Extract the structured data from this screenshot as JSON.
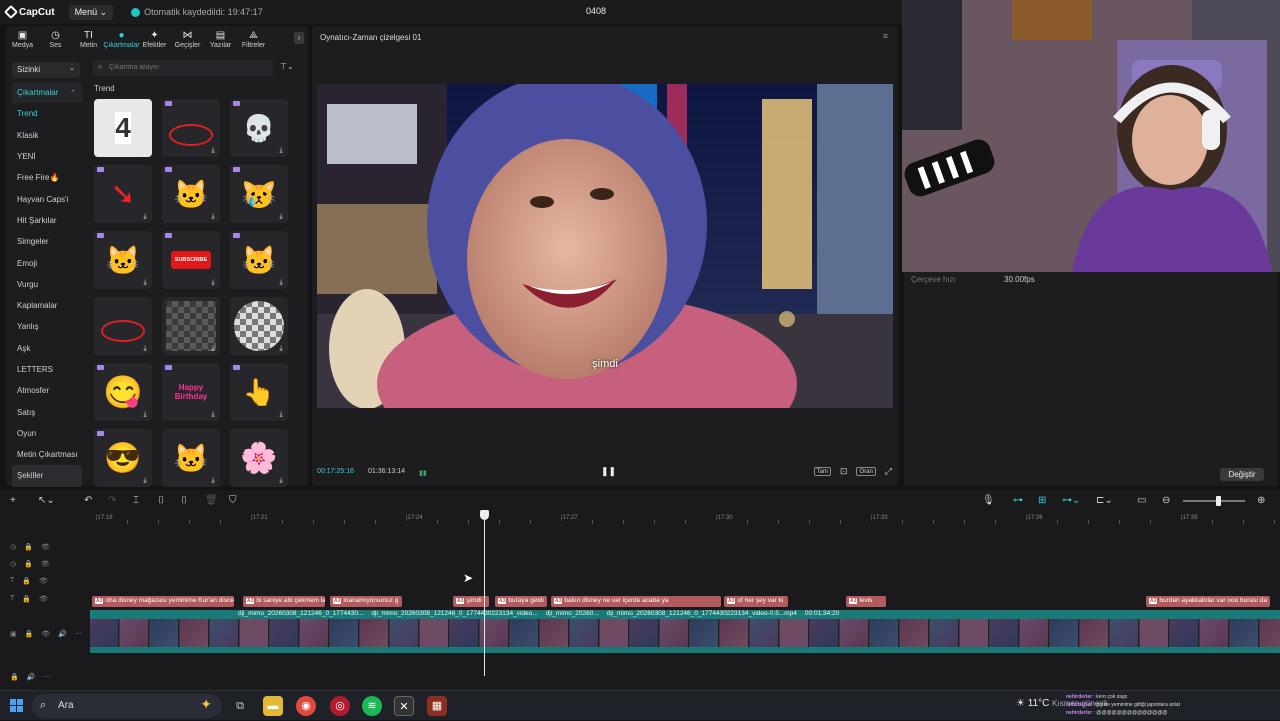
{
  "app": {
    "brand": "CapCut",
    "menu_label": "Menü",
    "autosave": "Otomatik kaydedildi: 19:47:17",
    "project_name": "0408"
  },
  "toolbar": {
    "items": [
      {
        "label": "Medya",
        "icon": "media-icon",
        "glyph": "▣"
      },
      {
        "label": "Ses",
        "icon": "audio-icon",
        "glyph": "◷"
      },
      {
        "label": "Metin",
        "icon": "text-icon",
        "glyph": "TI"
      },
      {
        "label": "Çıkartmalar",
        "icon": "sticker-icon",
        "glyph": "●"
      },
      {
        "label": "Efektler",
        "icon": "effects-icon",
        "glyph": "✦"
      },
      {
        "label": "Geçişler",
        "icon": "transitions-icon",
        "glyph": "⋈"
      },
      {
        "label": "Yazılar",
        "icon": "captions-icon",
        "glyph": "▤"
      },
      {
        "label": "Filtreler",
        "icon": "filters-icon",
        "glyph": "⟁"
      }
    ],
    "active_index": 3
  },
  "left_panel": {
    "dropdown": "Sizinki",
    "parent_category": "Çıkartmalar",
    "categories": [
      "Trend",
      "Klasik",
      "YENİ",
      "Free Fire🔥",
      "Hayvan Caps'i",
      "Hit Şarkılar",
      "Simgeler",
      "Emoji",
      "Vurgu",
      "Kaplamalar",
      "Yanlış",
      "Aşk",
      "LETTERS",
      "Atmosfer",
      "Satış",
      "Oyun",
      "Metin Çıkartması",
      "Şekiller"
    ],
    "selected_category": "Trend",
    "search_placeholder": "Çıkartma arayın",
    "section_title": "Trend",
    "stickers": [
      {
        "name": "number-four-sticker",
        "glyph": "4"
      },
      {
        "name": "red-crown-circle-sticker",
        "glyph": ""
      },
      {
        "name": "skull-sticker",
        "glyph": "💀"
      },
      {
        "name": "red-arrow-sticker",
        "glyph": "➘"
      },
      {
        "name": "cat-flowers-sticker",
        "glyph": "🐱"
      },
      {
        "name": "crying-cat-sticker",
        "glyph": "😿"
      },
      {
        "name": "cat-heart-sticker",
        "glyph": "🐱"
      },
      {
        "name": "subscribe-button-sticker",
        "glyph": "SUBSCRIBE"
      },
      {
        "name": "cat-bouquet-sticker",
        "glyph": "🐱"
      },
      {
        "name": "red-circle-arrow-sticker",
        "glyph": ""
      },
      {
        "name": "pixel-blur-sticker",
        "glyph": ""
      },
      {
        "name": "mosaic-circle-sticker",
        "glyph": ""
      },
      {
        "name": "yummy-emoji-sticker",
        "glyph": "😋"
      },
      {
        "name": "happy-birthday-sticker",
        "glyph": "Happy Birthday"
      },
      {
        "name": "pointing-hand-sticker",
        "glyph": "👆"
      },
      {
        "name": "cool-emoji-sticker",
        "glyph": "😎"
      },
      {
        "name": "party-cat-sticker",
        "glyph": "🐱"
      },
      {
        "name": "pink-flower-sticker",
        "glyph": "🌸"
      }
    ]
  },
  "player": {
    "title": "Oynatıcı-Zaman çizelgesi 01",
    "subtitle": "şimdi",
    "current_time": "00:17:25:16",
    "total_time": "01:36:13:14",
    "controls": [
      "Tam",
      "Oran"
    ]
  },
  "right_panel": {
    "fps_label": "Çerçeve hızı",
    "fps_value": "30.00fps",
    "change_button": "Değiştir"
  },
  "timeline": {
    "ruler": [
      "|17:18",
      "|17:21",
      "|17:24",
      "|17:27",
      "|17:30",
      "|17:33",
      "|17:36",
      "|17:39"
    ],
    "text_clips": [
      {
        "text": "oha disney mağazası yeminime Kur'an disney"
      },
      {
        "text": "bi saniye abi çekmem lazı"
      },
      {
        "text": "inanamıyorsunuz g"
      },
      {
        "text": "şimdi"
      },
      {
        "text": "buraya geldi"
      },
      {
        "text": "bakın disney ne var içerde acaba ya"
      },
      {
        "text": "of her şey var ki"
      },
      {
        "text": "levis"
      },
      {
        "text": "burdan ayakkabılar var ooo burası da"
      }
    ],
    "video_labels": [
      "dji_mimo_20260308_121246_0_1774430...",
      "dji_mimo_20260308_121246_0_1774430223134_video...",
      "dji_mimo_20260...",
      "dji_mimo_20260308_121246_0_1774430223134_video-0.5...mp4",
      "00:01:34:20"
    ],
    "clip_badge": "A3"
  },
  "taskbar": {
    "search": "Ara",
    "weather": "11°C",
    "weather_sub": "Kısmen güneşli"
  },
  "chat": [
    {
      "user": "nehirderler",
      "msg": "kero çok zayp"
    },
    {
      "user": "nehirderler",
      "msg": "gel de yeminime gittiği japonlara anlat "
    },
    {
      "user": "nehirderler",
      "msg": "@@@@@@@@@@@@@@"
    }
  ],
  "colors": {
    "accent": "#35d0d8",
    "text_clip": "#b35a5d",
    "video_track": "#1a7a78"
  }
}
